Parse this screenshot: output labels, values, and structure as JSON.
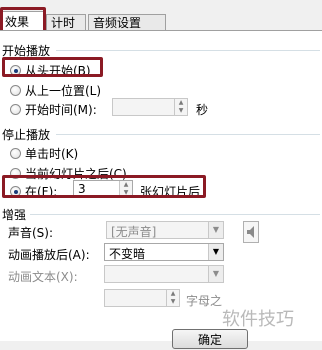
{
  "tabs": [
    {
      "label": "效果"
    },
    {
      "label": "计时"
    },
    {
      "label": "音频设置"
    }
  ],
  "start": {
    "section_label": "开始播放",
    "options": [
      {
        "label": "从头开始(B)",
        "checked": true
      },
      {
        "label": "从上一位置(L)",
        "checked": false
      },
      {
        "label": "开始时间(M):",
        "checked": false
      }
    ],
    "time_unit": "秒"
  },
  "stop": {
    "section_label": "停止播放",
    "options": [
      {
        "label": "单击时(K)",
        "checked": false
      },
      {
        "label": "当前幻灯片之后(C)",
        "checked": false
      },
      {
        "label": "在(F):",
        "checked": true
      }
    ],
    "slides_value": "3",
    "slides_suffix": "张幻灯片后"
  },
  "enhance": {
    "section_label": "增强",
    "sound_label": "声音(S):",
    "sound_value": "[无声音]",
    "after_anim_label": "动画播放后(A):",
    "after_anim_value": "不变暗",
    "anim_text_label": "动画文本(X):",
    "letter_suffix": "字母之"
  },
  "ok_button": "确定",
  "watermark": "软件技巧",
  "colors": {
    "highlight": "#8b1a24"
  }
}
